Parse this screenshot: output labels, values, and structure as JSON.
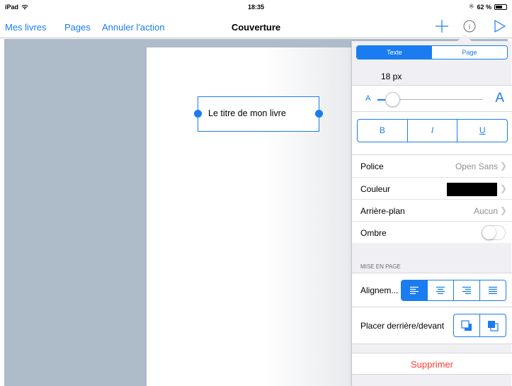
{
  "status_bar": {
    "device": "iPad",
    "time": "18:35",
    "battery": "62 %",
    "battery_level": 0.62
  },
  "nav": {
    "links": {
      "my_books": "Mes livres",
      "pages": "Pages",
      "undo": "Annuler l'action"
    },
    "title": "Couverture",
    "icons": [
      "plus-icon",
      "info-icon",
      "play-icon"
    ]
  },
  "canvas": {
    "title_text": "Le titre de mon livre"
  },
  "inspector": {
    "tabs": {
      "text": "Texte",
      "page": "Page",
      "active": "Texte"
    },
    "font_size": "18 px",
    "font_size_slider_level": 0.1,
    "size_small_label": "A",
    "size_large_label": "A",
    "style_buttons": {
      "bold": "B",
      "italic": "I",
      "underline": "U"
    },
    "rows": {
      "font_label": "Police",
      "font_value": "Open Sans",
      "color_label": "Couleur",
      "color_value": "#000000",
      "background_label": "Arrière-plan",
      "background_value": "Aucun",
      "shadow_label": "Ombre",
      "shadow_on": false
    },
    "layout_header": "MISE EN PAGE",
    "alignment_label": "Alignem...",
    "alignment_options": [
      "left",
      "center",
      "right",
      "justify"
    ],
    "alignment_selected": "left",
    "layer_label": "Placer derrière/devant",
    "delete_label": "Supprimer"
  },
  "colors": {
    "accent": "#1a7cf0",
    "destructive": "#ff3b30",
    "workspace": "#aebbc8"
  }
}
